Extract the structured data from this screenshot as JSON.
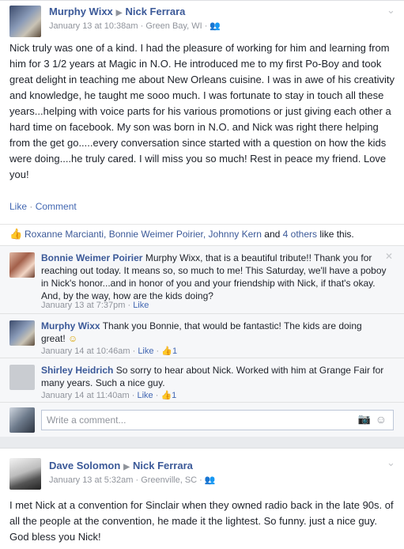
{
  "post1": {
    "author": "Murphy Wixx",
    "target": "Nick Ferrara",
    "date": "January 13 at 10:38am",
    "location": "Green Bay, WI",
    "body": "Nick truly was one of a kind. I had the pleasure of working for him and learning from him for 3 1/2 years at Magic in N.O. He introduced me to my first Po-Boy and took great delight in teaching me about New Orleans cuisine. I was in awe of his creativity and knowledge, he taught me sooo much. I was fortunate to stay in touch all these years...helping with voice parts for his various promotions or just giving each other a hard time on facebook. My son was born in N.O. and Nick was right there helping from the get go.....every conversation since started with a question on how the kids were doing....he truly cared. I will miss you so much! Rest in peace my friend. Love you!",
    "like_label": "Like",
    "comment_label": "Comment",
    "likes": {
      "names": "Roxanne Marcianti, Bonnie Weimer Poirier, Johnny Kern",
      "and": "and",
      "others": "4 others",
      "suffix": "like this."
    },
    "comments": [
      {
        "author": "Bonnie Weimer Poirier",
        "text": "Murphy Wixx, that is a beautiful tribute!! Thank you for reaching out today. It means so, so much to me! This Saturday, we'll have a poboy in Nick's honor...and in honor of you and your friendship with Nick, if that's okay. And, by the way, how are the kids doing?",
        "date": "January 13 at 7:37pm",
        "like": "Like",
        "like_count": ""
      },
      {
        "author": "Murphy Wixx",
        "text": "Thank you Bonnie, that would be fantastic! The kids are doing great!",
        "date": "January 14 at 10:46am",
        "like": "Like",
        "like_count": "1"
      },
      {
        "author": "Shirley Heidrich",
        "text": "So sorry to hear about Nick. Worked with him at Grange Fair for many years. Such a nice guy.",
        "date": "January 14 at 11:40am",
        "like": "Like",
        "like_count": "1"
      }
    ],
    "write_placeholder": "Write a comment..."
  },
  "post2": {
    "author": "Dave Solomon",
    "target": "Nick Ferrara",
    "date": "January 13 at 5:32am",
    "location": "Greenville, SC",
    "body": "I met Nick at a convention for Sinclair when they owned radio back in the late 90s. of all the people at the convention, he made it the lightest. So funny. just a nice guy. God bless you Nick!"
  },
  "colors": {
    "link": "#3b5998",
    "meta": "#90949c",
    "bg": "#e9ebee"
  },
  "icons": [
    "chevron-down-icon",
    "friends-icon",
    "thumbs-up-icon",
    "close-icon",
    "smile-icon",
    "camera-icon"
  ]
}
